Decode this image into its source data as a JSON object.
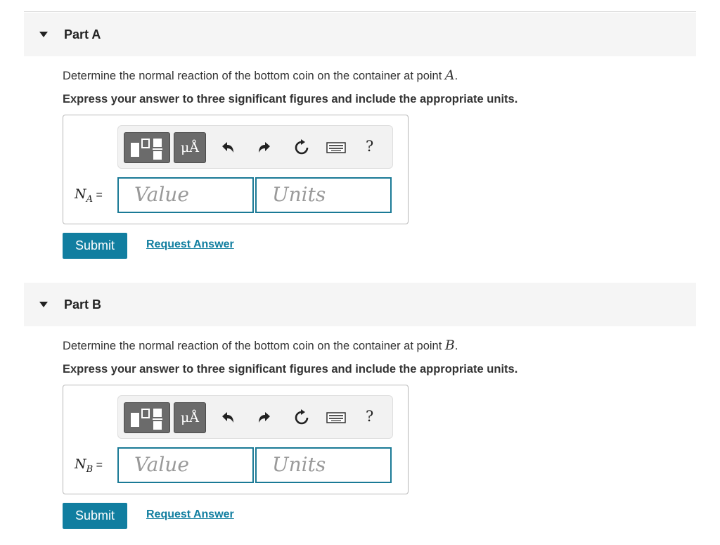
{
  "parts": [
    {
      "title": "Part A",
      "question_prefix": "Determine the normal reaction of the bottom coin on the container at point ",
      "point": "A",
      "question_suffix": ".",
      "instructions": "Express your answer to three significant figures and include the appropriate units.",
      "label_var": "N",
      "label_sub": "A",
      "label_eq": " =",
      "value_placeholder": "Value",
      "units_placeholder": "Units",
      "units_symbol": "μÅ",
      "help": "?",
      "submit": "Submit",
      "request_answer": "Request Answer"
    },
    {
      "title": "Part B",
      "question_prefix": "Determine the normal reaction of the bottom coin on the container at point ",
      "point": "B",
      "question_suffix": ".",
      "instructions": "Express your answer to three significant figures and include the appropriate units.",
      "label_var": "N",
      "label_sub": "B",
      "label_eq": " =",
      "value_placeholder": "Value",
      "units_placeholder": "Units",
      "units_symbol": "μÅ",
      "help": "?",
      "submit": "Submit",
      "request_answer": "Request Answer"
    }
  ],
  "toolbar_icons": [
    "templates-icon",
    "undo-icon",
    "redo-icon",
    "reset-icon",
    "keyboard-icon",
    "help-icon"
  ],
  "colors": {
    "accent": "#117ea0",
    "field_border": "#1a7a96",
    "header_bg": "#f5f5f5"
  }
}
